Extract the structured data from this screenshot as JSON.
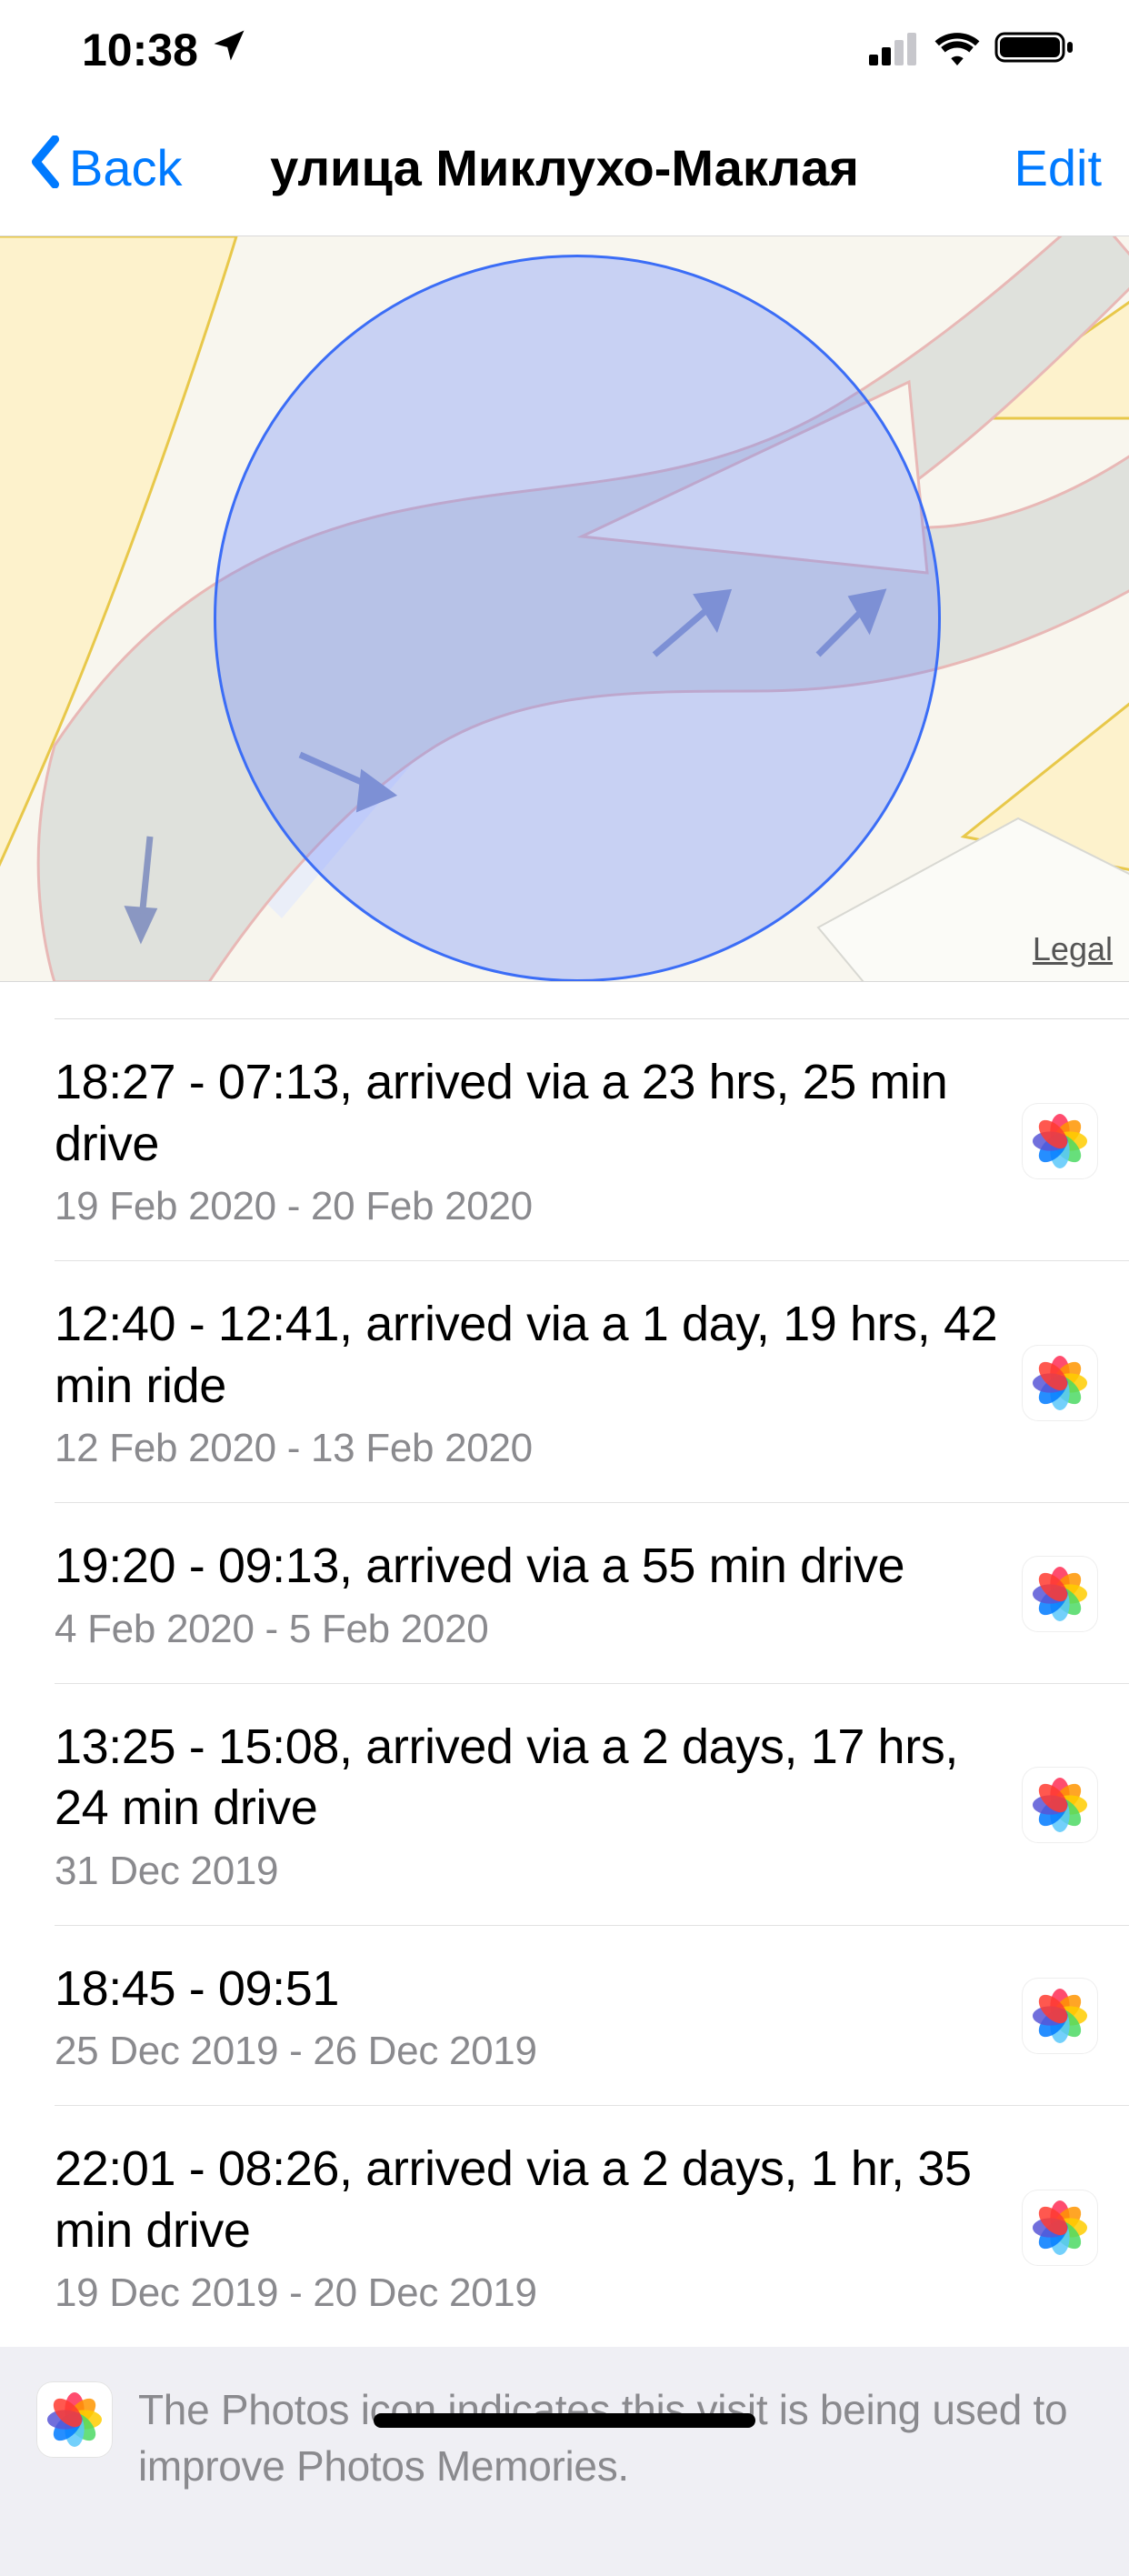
{
  "status": {
    "time": "10:38",
    "locationIconName": "location-arrow",
    "signalIconName": "cellular",
    "wifiIconName": "wifi",
    "batteryIconName": "battery-full"
  },
  "nav": {
    "backLabel": "Back",
    "title": "улица Миклухо-Маклая",
    "editLabel": "Edit"
  },
  "map": {
    "legalLabel": "Legal",
    "accentColor": "#3b6df6"
  },
  "visits": [
    {
      "title": "18:27 - 07:13, arrived via a 23 hrs, 25 min drive",
      "sub": "19 Feb 2020 - 20 Feb 2020",
      "photos": true
    },
    {
      "title": "12:40 - 12:41, arrived via a 1 day, 19 hrs, 42 min ride",
      "sub": "12 Feb 2020 - 13 Feb 2020",
      "photos": true
    },
    {
      "title": "19:20 - 09:13, arrived via a 55 min drive",
      "sub": "4 Feb 2020 - 5 Feb 2020",
      "photos": true
    },
    {
      "title": "13:25 - 15:08, arrived via a 2 days, 17 hrs, 24 min drive",
      "sub": "31 Dec 2019",
      "photos": true
    },
    {
      "title": "18:45 - 09:51",
      "sub": "25 Dec 2019 - 26 Dec 2019",
      "photos": true
    },
    {
      "title": "22:01 - 08:26, arrived via a 2 days, 1 hr, 35 min drive",
      "sub": "19 Dec 2019 - 20 Dec 2019",
      "photos": true
    }
  ],
  "footer": {
    "text": "The Photos icon indicates this visit is being used to improve Photos Memories."
  }
}
